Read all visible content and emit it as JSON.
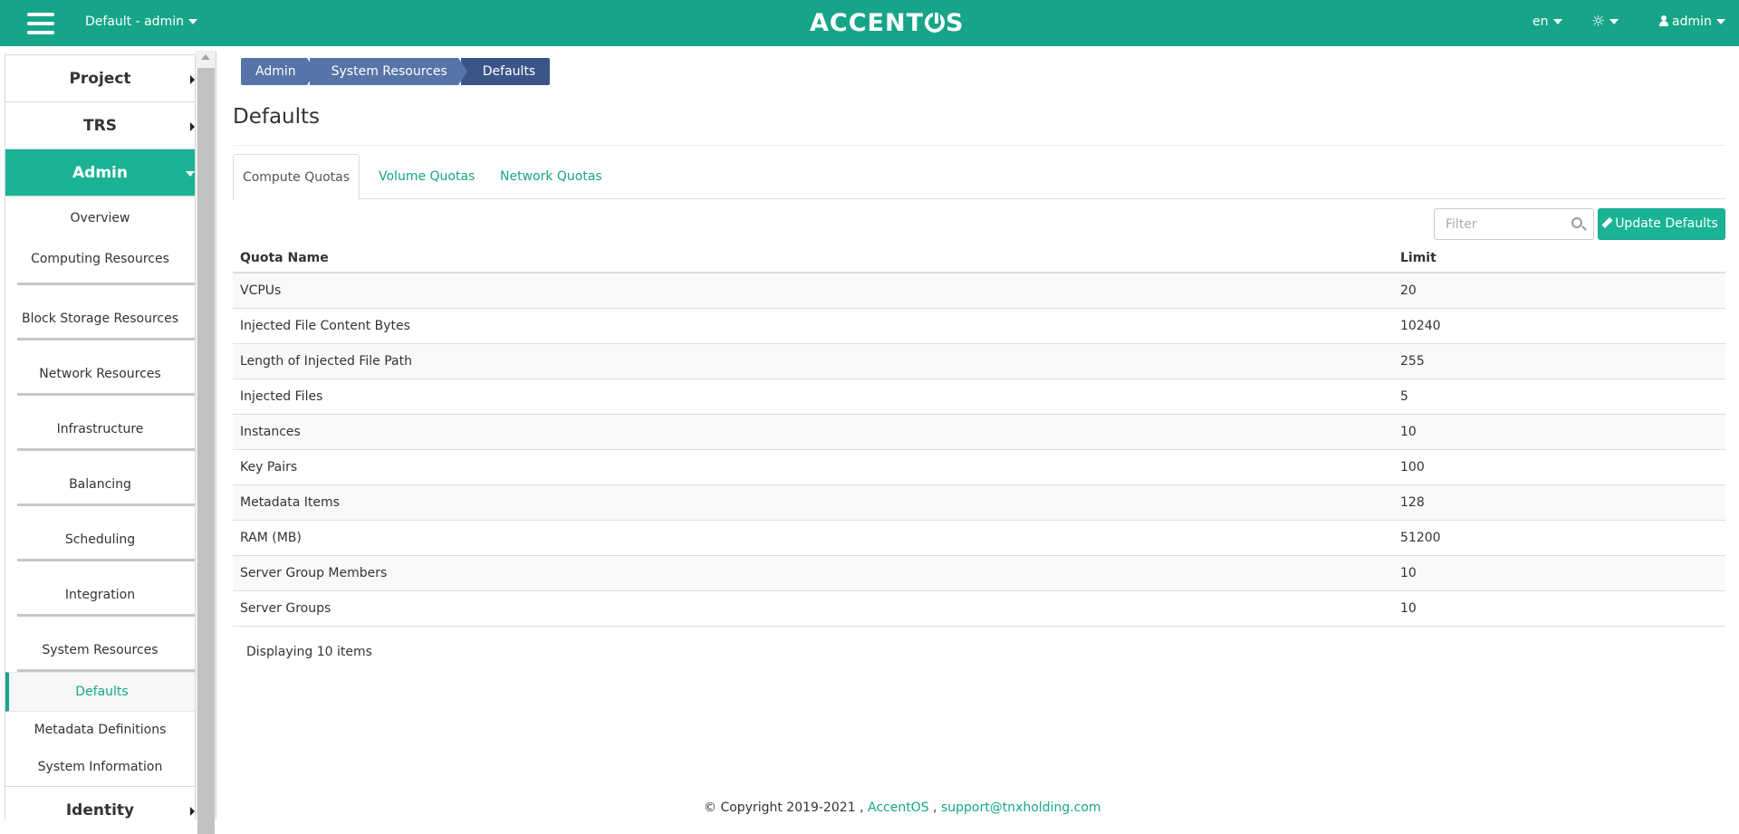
{
  "navbar": {
    "project_label": "Default - admin",
    "brand": {
      "before": "ACCENT",
      "after": "S"
    },
    "language": "en",
    "user": "admin"
  },
  "sidebar": {
    "sections_top": [
      "Project",
      "TRS"
    ],
    "active_section": "Admin",
    "groups": [
      "Overview",
      "Computing Resources",
      "Block Storage Resources",
      "Network Resources",
      "Infrastructure",
      "Balancing",
      "Scheduling",
      "Integration",
      "System Resources"
    ],
    "sub_items": [
      "Defaults",
      "Metadata Definitions",
      "System Information"
    ],
    "bottom_section": "Identity"
  },
  "breadcrumb": [
    "Admin",
    "System Resources",
    "Defaults"
  ],
  "page_title": "Defaults",
  "tabs": [
    "Compute Quotas",
    "Volume Quotas",
    "Network Quotas"
  ],
  "filter_placeholder": "Filter",
  "update_button": "Update Defaults",
  "table": {
    "headers": [
      "Quota Name",
      "Limit"
    ],
    "rows": [
      [
        "VCPUs",
        "20"
      ],
      [
        "Injected File Content Bytes",
        "10240"
      ],
      [
        "Length of Injected File Path",
        "255"
      ],
      [
        "Injected Files",
        "5"
      ],
      [
        "Instances",
        "10"
      ],
      [
        "Key Pairs",
        "100"
      ],
      [
        "Metadata Items",
        "128"
      ],
      [
        "RAM (MB)",
        "51200"
      ],
      [
        "Server Group Members",
        "10"
      ],
      [
        "Server Groups",
        "10"
      ]
    ],
    "footer": "Displaying 10 items"
  },
  "copyright": {
    "text": "© Copyright 2019-2021 ,",
    "link1": "AccentOS",
    "sep": ",",
    "link2": "support@tnxholding.com"
  },
  "colors": {
    "primary": "#17a589",
    "accent": "#1ab394",
    "crumb": "#5674a7",
    "crumb_active": "#3a5688"
  }
}
